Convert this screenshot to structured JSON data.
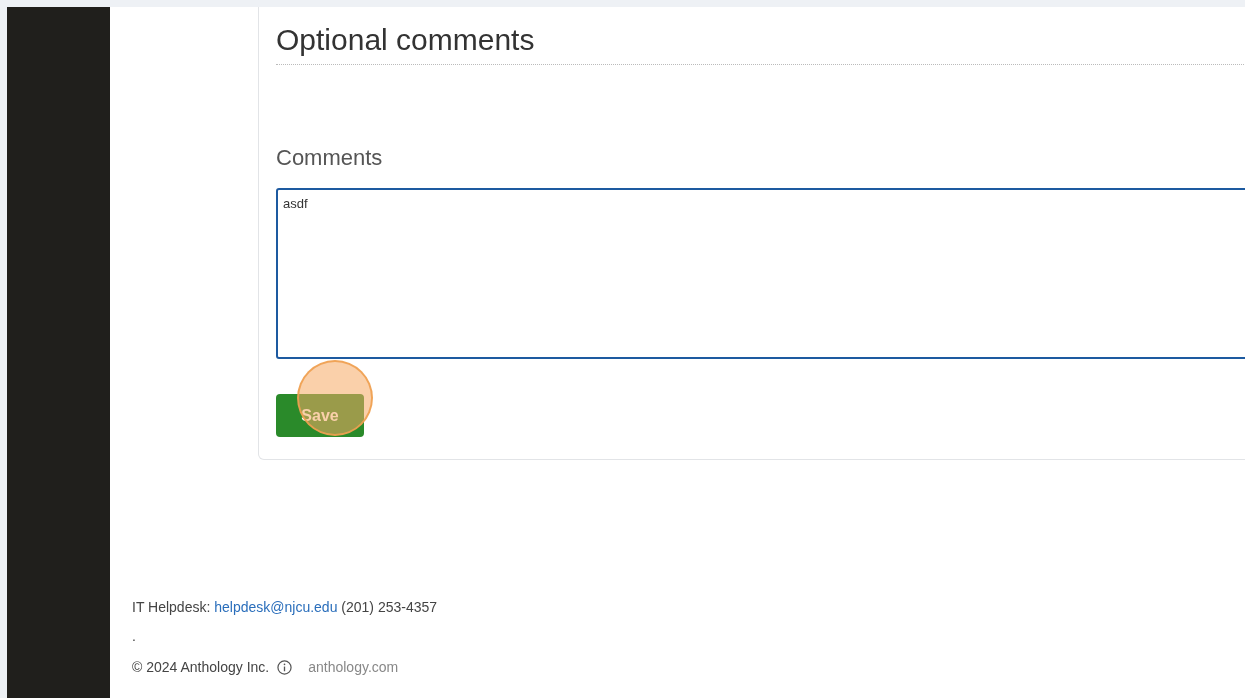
{
  "section": {
    "heading": "Optional comments"
  },
  "comments": {
    "label": "Comments",
    "value": "asdf"
  },
  "save_button": {
    "label": "Save",
    "highlighted": true
  },
  "footer": {
    "helpdesk_label": "IT Helpdesk:",
    "helpdesk_email": "helpdesk@njcu.edu",
    "helpdesk_phone": "(201) 253-4357",
    "separator": ".",
    "copyright": "© 2024 Anthology Inc.",
    "site_link": "anthology.com"
  }
}
